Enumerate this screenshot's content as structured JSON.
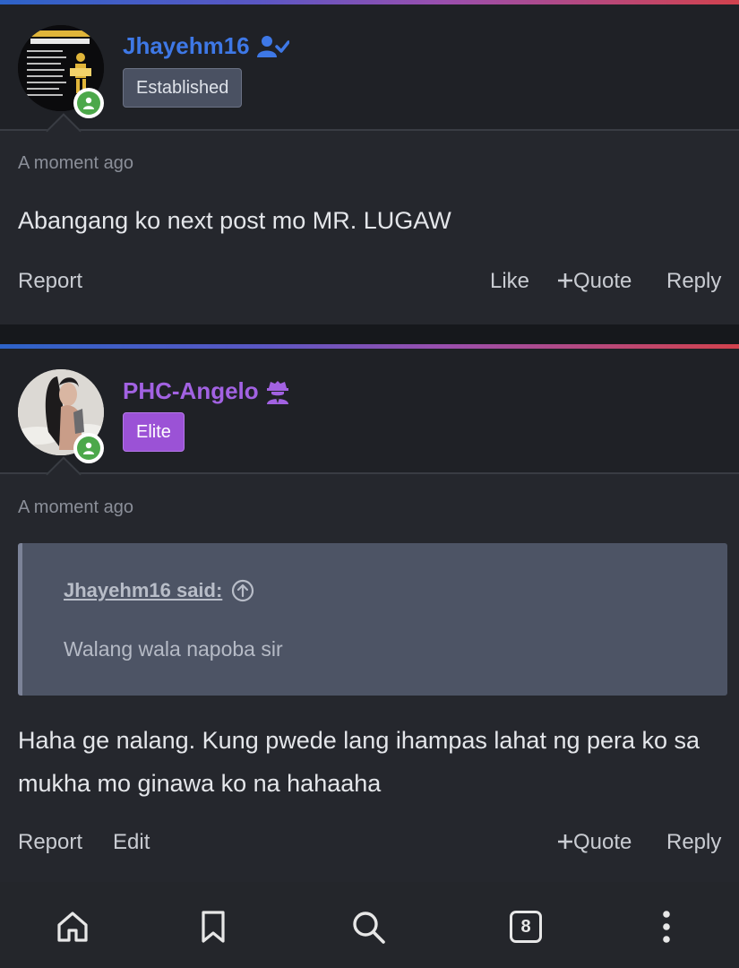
{
  "posts": [
    {
      "username": "Jhayehm16",
      "username_icon": "user-check-icon",
      "badge": "Established",
      "timestamp": "A moment ago",
      "message": "Abangang ko next post mo MR. LUGAW",
      "actions": {
        "report": "Report",
        "like": "Like",
        "quote": "Quote",
        "reply": "Reply"
      },
      "username_color": "#3e78e6",
      "badge_color": "#4a5162"
    },
    {
      "username": "PHC-Angelo",
      "username_icon": "user-secret-icon",
      "badge": "Elite",
      "timestamp": "A moment ago",
      "quote": {
        "author": "Jhayehm16 said:",
        "text": "Walang wala napoba sir"
      },
      "message": "Haha ge nalang. Kung pwede lang ihampas lahat ng pera ko sa mukha mo ginawa ko na hahaaha",
      "actions": {
        "report": "Report",
        "edit": "Edit",
        "quote": "Quote",
        "reply": "Reply"
      },
      "username_color": "#a262e2",
      "badge_color": "#9b52d6"
    }
  ],
  "bottom_nav": {
    "items": [
      "home-icon",
      "bookmark-icon",
      "search-icon",
      "tabs-icon",
      "more-vertical-icon"
    ],
    "tab_count": "8"
  }
}
